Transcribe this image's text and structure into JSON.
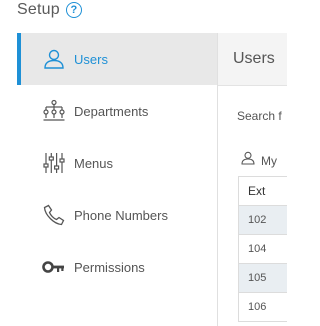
{
  "header": {
    "title": "Setup",
    "help_icon": "help-circle-icon"
  },
  "colors": {
    "accent": "#1e90d6",
    "active_bg": "#e8e8e8",
    "row_alt": "#e9eef2"
  },
  "sidebar": {
    "items": [
      {
        "label": "Users",
        "icon": "user-icon",
        "active": true
      },
      {
        "label": "Departments",
        "icon": "org-chart-icon",
        "active": false
      },
      {
        "label": "Menus",
        "icon": "sliders-icon",
        "active": false
      },
      {
        "label": "Phone Numbers",
        "icon": "phone-icon",
        "active": false
      },
      {
        "label": "Permissions",
        "icon": "key-icon",
        "active": false
      }
    ]
  },
  "main": {
    "title": "Users",
    "search_label": "Search f",
    "my_label": "My",
    "table": {
      "headers": [
        "Ext"
      ],
      "rows": [
        "102",
        "104",
        "105",
        "106"
      ]
    }
  }
}
